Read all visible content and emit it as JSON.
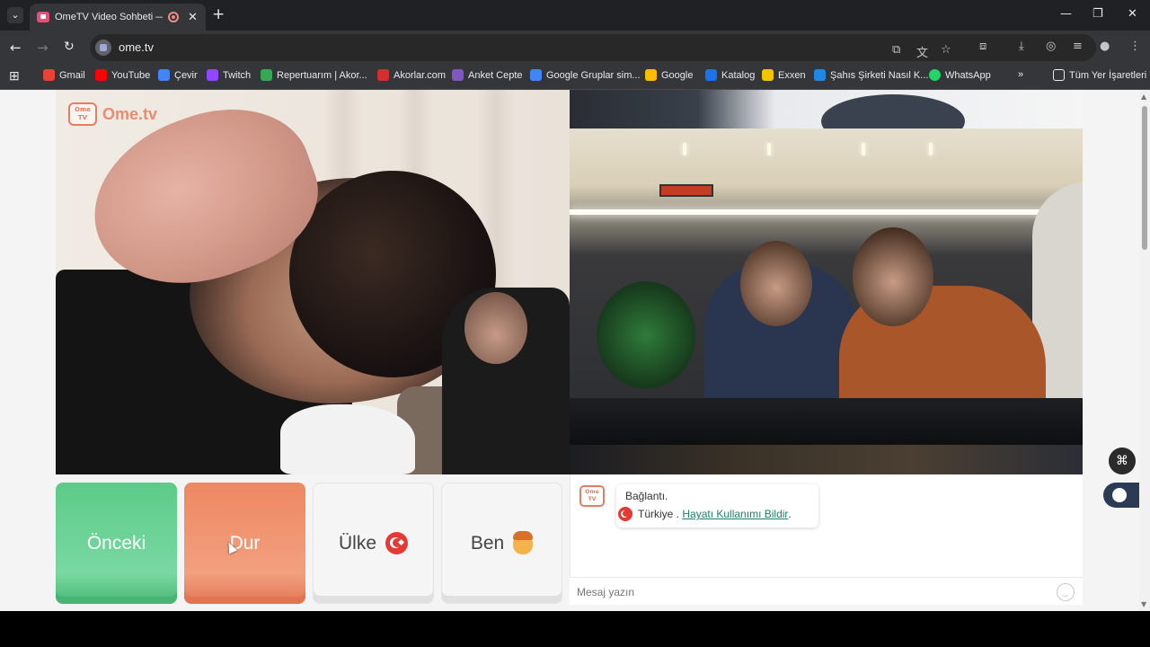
{
  "browser": {
    "tab_title": "OmeTV Video Sohbeti — O",
    "url": "ome.tv",
    "bookmarks": [
      {
        "label": "Gmail",
        "color": "#ea4335"
      },
      {
        "label": "YouTube",
        "color": "#ff0000"
      },
      {
        "label": "Çevir",
        "color": "#4285f4"
      },
      {
        "label": "Twitch",
        "color": "#9146ff"
      },
      {
        "label": "Repertuarım | Akor...",
        "color": "#34a853"
      },
      {
        "label": "Akorlar.com",
        "color": "#d32f2f"
      },
      {
        "label": "Anket Cepte",
        "color": "#7e57c2"
      },
      {
        "label": "Google Gruplar sim...",
        "color": "#4285f4"
      },
      {
        "label": "Google",
        "color": "#fbbc05"
      },
      {
        "label": "Katalog",
        "color": "#1a73e8"
      },
      {
        "label": "Exxen",
        "color": "#f5c400"
      },
      {
        "label": "Şahıs Şirketi Nasıl K...",
        "color": "#1e88e5"
      },
      {
        "label": "WhatsApp",
        "color": "#25d366"
      }
    ],
    "all_bookmarks": "Tüm Yer İşaretleri"
  },
  "site": {
    "logo_badge": "Ome TV",
    "logo_text": "Ome.tv"
  },
  "controls": {
    "prev_label": "Önceki",
    "stop_label": "Dur",
    "country_label": "Ülke",
    "me_label": "Ben"
  },
  "chat": {
    "avatar_badge": "Ome TV",
    "status": "Bağlantı.",
    "country": "Türkiye .",
    "link": "Hayatı Kullanımı Bildir",
    "link_suffix": ".",
    "placeholder": "Mesaj yazın"
  }
}
